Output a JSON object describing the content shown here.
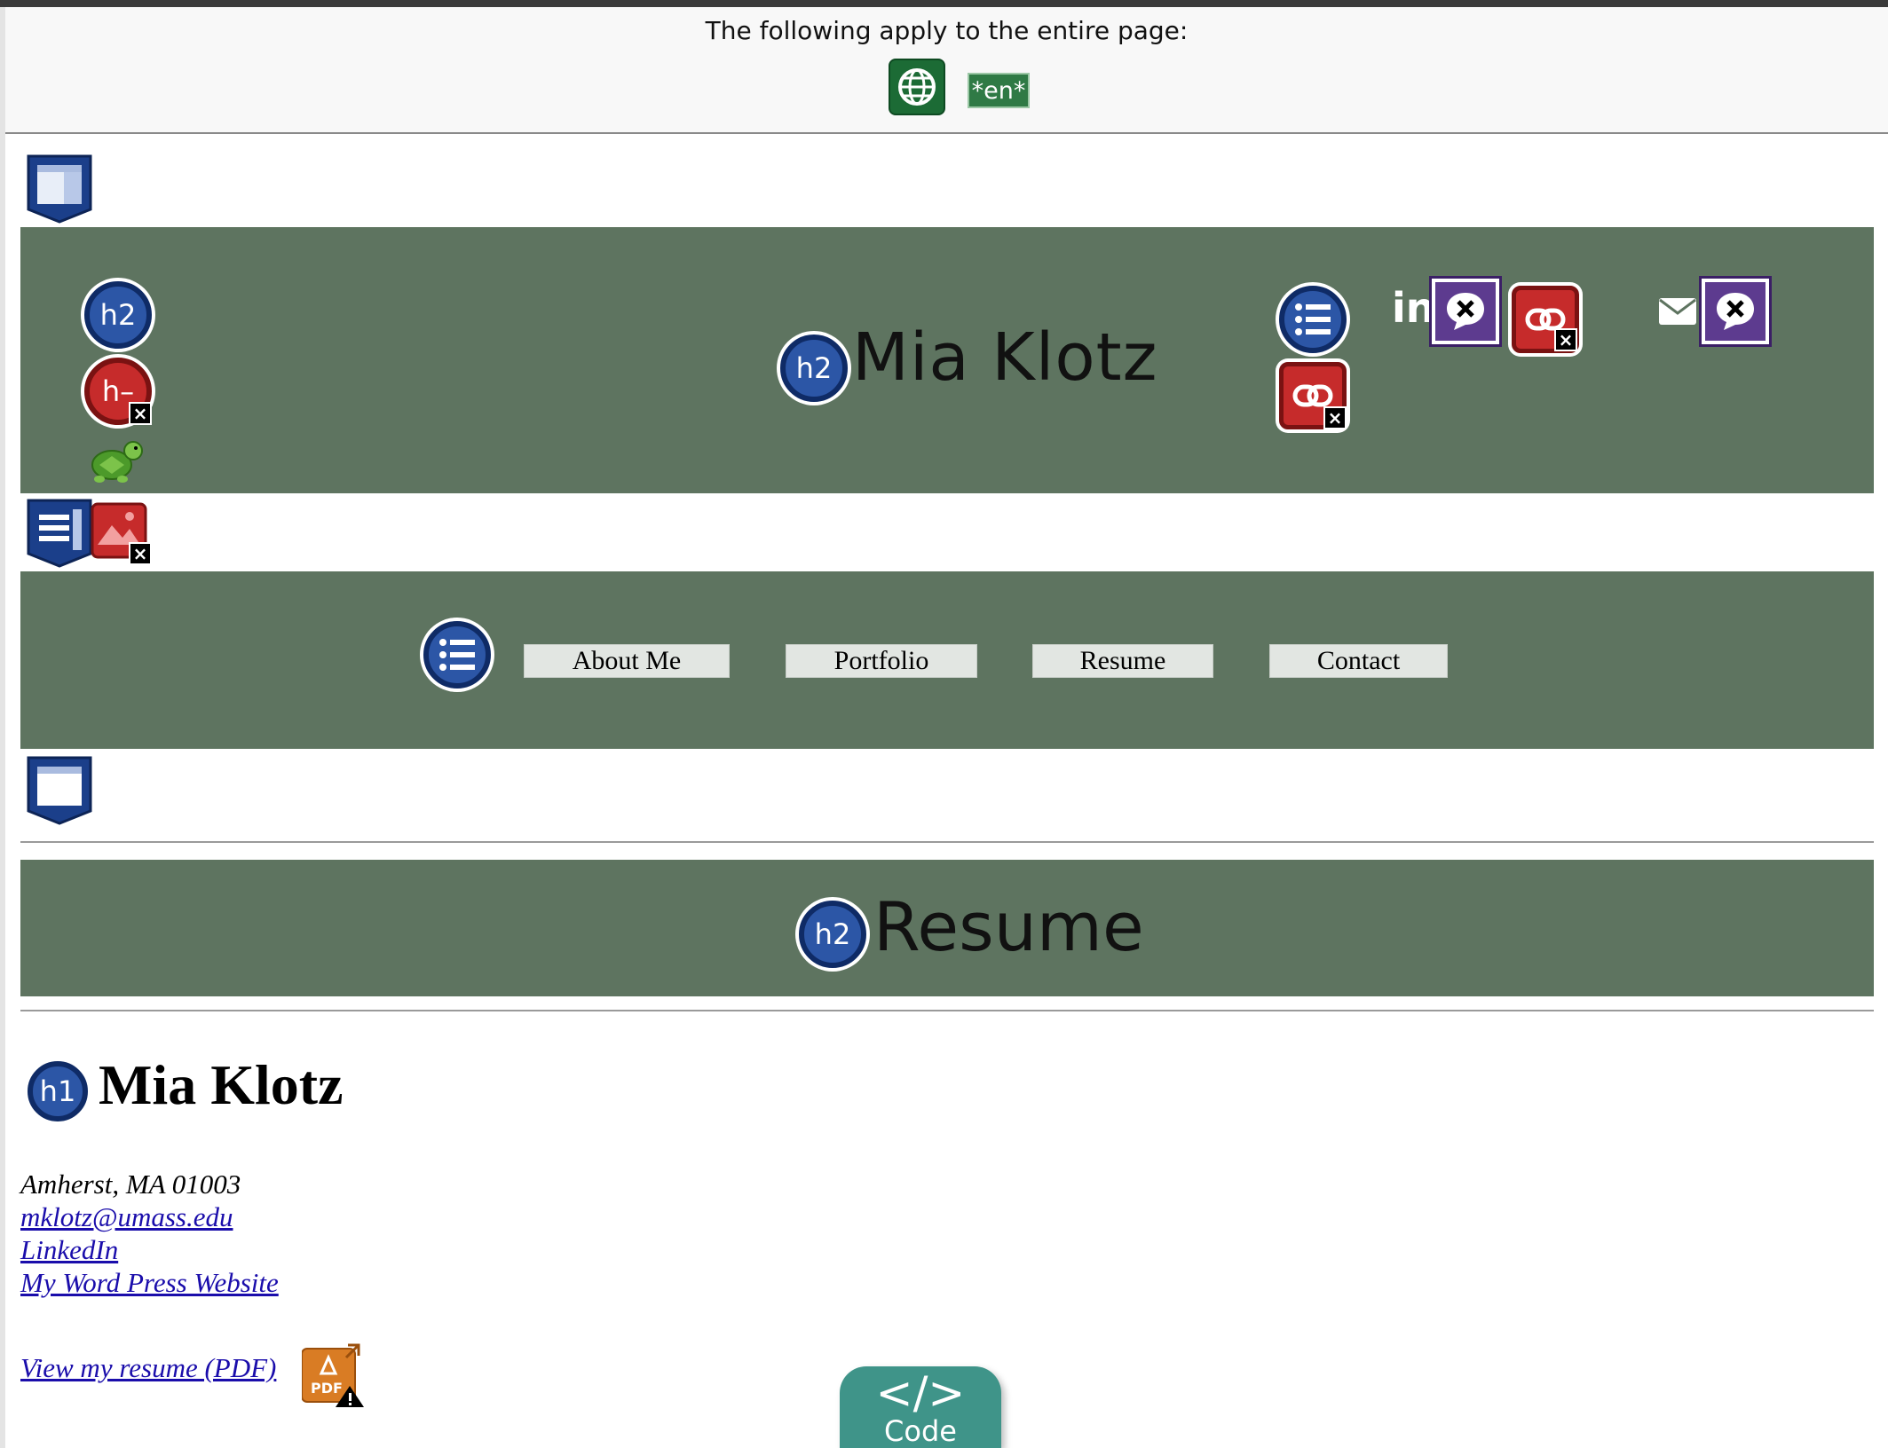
{
  "summary": {
    "text": "The following apply to the entire page:",
    "language": "*en*"
  },
  "header": {
    "site_title": "Mia Klotz",
    "social_linkedin": "in"
  },
  "nav": {
    "items": [
      "About Me",
      "Portfolio",
      "Resume",
      "Contact"
    ]
  },
  "page": {
    "heading": "Resume"
  },
  "badges": {
    "h2": "h2",
    "h1": "h1",
    "hdash": "h–",
    "x": "×"
  },
  "resume": {
    "name": "Mia Klotz",
    "address": "Amherst, MA 01003",
    "email": "mklotz@umass.edu",
    "linkedin": "LinkedIn",
    "website": "My Word Press Website",
    "pdf_link": "View my resume (PDF)"
  },
  "code_tab": {
    "glyph": "</>",
    "label": "Code"
  },
  "colors": {
    "band": "#5e7460",
    "badge_blue": "#2c56a6",
    "badge_red": "#c62b2b",
    "link": "#1a0dab",
    "code_tab": "#3f9489"
  }
}
